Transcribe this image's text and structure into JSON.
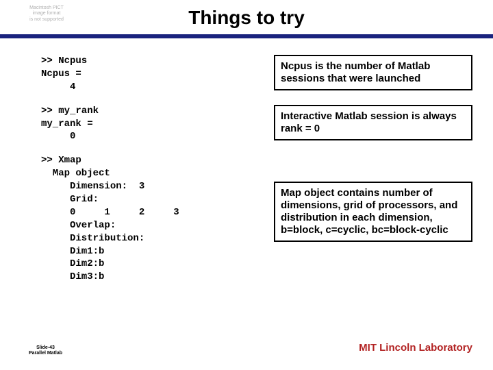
{
  "placeholder_line1": "Macintosh PICT",
  "placeholder_line2": "image format",
  "placeholder_line3": "is not supported",
  "title": "Things to try",
  "code": {
    "ncpus": ">> Ncpus\nNcpus =\n     4",
    "myrank": ">> my_rank\nmy_rank =\n     0",
    "xmap": ">> Xmap\n  Map object\n     Dimension:  3\n     Grid:\n     0     1     2     3\n     Overlap:\n     Distribution:\n     Dim1:b\n     Dim2:b\n     Dim3:b"
  },
  "notes": {
    "n1": "Ncpus is the number of Matlab sessions that were launched",
    "n2": "Interactive Matlab session is always rank = 0",
    "n3": "Map object contains number of dimensions, grid of processors, and distribution in each dimension, b=block, c=cyclic, bc=block-cyclic"
  },
  "footer": {
    "slide": "Slide-43",
    "sub": "Parallel Matlab",
    "lab": "MIT Lincoln Laboratory"
  }
}
